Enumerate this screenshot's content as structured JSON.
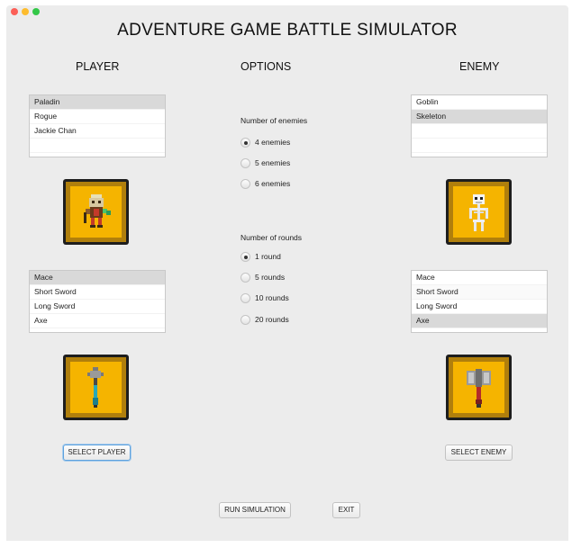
{
  "window": {
    "title": "ADVENTURE GAME BATTLE SIMULATOR"
  },
  "player": {
    "heading": "PLAYER",
    "classes": [
      {
        "label": "Paladin",
        "selected": true
      },
      {
        "label": "Rogue",
        "selected": false
      },
      {
        "label": "Jackie Chan",
        "selected": false
      }
    ],
    "portrait_icon": "paladin-sprite",
    "weapons": [
      {
        "label": "Mace",
        "selected": true
      },
      {
        "label": "Short Sword",
        "selected": false
      },
      {
        "label": "Long Sword",
        "selected": false
      },
      {
        "label": "Axe",
        "selected": false
      }
    ],
    "weapon_icon": "mace-sprite",
    "select_button": "SELECT PLAYER"
  },
  "options": {
    "heading": "OPTIONS",
    "enemies_label": "Number of enemies",
    "enemies": [
      {
        "label": "4 enemies",
        "selected": true
      },
      {
        "label": "5 enemies",
        "selected": false
      },
      {
        "label": "6 enemies",
        "selected": false
      }
    ],
    "rounds_label": "Number of rounds",
    "rounds": [
      {
        "label": "1 round",
        "selected": true
      },
      {
        "label": "5 rounds",
        "selected": false
      },
      {
        "label": "10 rounds",
        "selected": false
      },
      {
        "label": "20 rounds",
        "selected": false
      }
    ]
  },
  "enemy": {
    "heading": "ENEMY",
    "types": [
      {
        "label": "Goblin",
        "selected": false
      },
      {
        "label": "Skeleton",
        "selected": true
      }
    ],
    "portrait_icon": "skeleton-sprite",
    "weapons": [
      {
        "label": "Mace",
        "selected": false
      },
      {
        "label": "Short Sword",
        "selected": false
      },
      {
        "label": "Long Sword",
        "selected": false
      },
      {
        "label": "Axe",
        "selected": true
      }
    ],
    "weapon_icon": "axe-sprite",
    "select_button": "SELECT ENEMY"
  },
  "footer": {
    "run_button": "RUN SIMULATION",
    "exit_button": "EXIT"
  },
  "colors": {
    "frame_gold": "#f5b400",
    "frame_dark": "#1d1d1d",
    "selection": "#d9d9d9",
    "focus_ring": "#5fa2dd"
  }
}
